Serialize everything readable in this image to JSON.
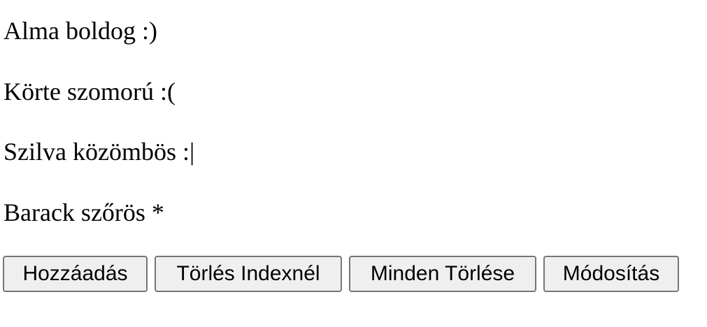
{
  "lines": [
    "Alma boldog :)",
    "Körte szomorú :(",
    "Szilva közömbös :|",
    "Barack szőrös *"
  ],
  "buttons": {
    "add": "Hozzáadás",
    "delete_at_index": "Törlés Indexnél",
    "delete_all": "Minden Törlése",
    "modify": "Módosítás"
  }
}
